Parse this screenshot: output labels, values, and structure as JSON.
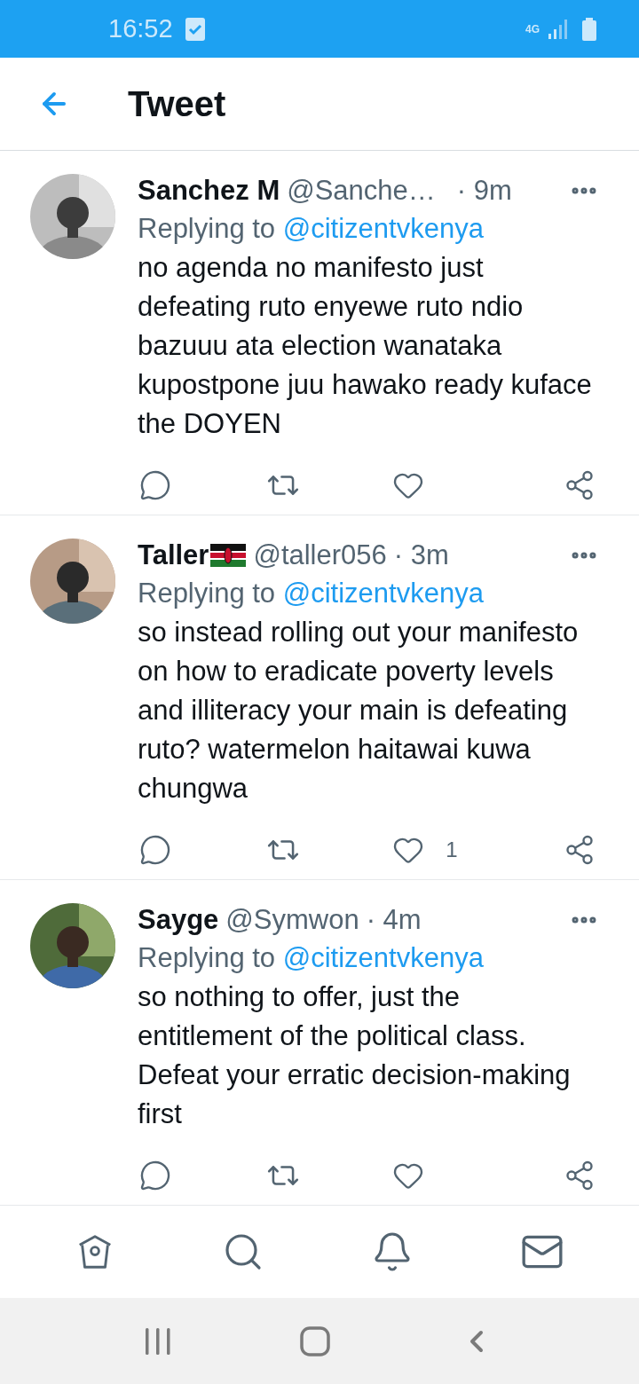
{
  "status_bar": {
    "time": "16:52",
    "network": "4G"
  },
  "header": {
    "title": "Tweet"
  },
  "tweets": [
    {
      "name": "Sanchez M",
      "handle": "@Sanche…",
      "time": "· 9m",
      "replying_label": "Replying to",
      "replying_to": "@citizentvkenya",
      "text": "no agenda no manifesto just defeating ruto enyewe ruto ndio bazuuu ata election wanataka kupostpone juu hawako ready kuface the DOYEN"
    },
    {
      "name": "Taller",
      "flag": true,
      "handle": "@taller056",
      "time": "· 3m",
      "replying_label": "Replying to",
      "replying_to": "@citizentvkenya",
      "text": "so instead  rolling out your manifesto  on how to eradicate poverty levels and illiteracy your main is defeating ruto? watermelon haitawai kuwa chungwa",
      "like_count": "1"
    },
    {
      "name": "Sayge",
      "handle": "@Symwon",
      "time": "· 4m",
      "replying_label": "Replying to",
      "replying_to": "@citizentvkenya",
      "text": "so nothing to offer, just the entitlement of the political class. Defeat your erratic decision-making first"
    }
  ]
}
